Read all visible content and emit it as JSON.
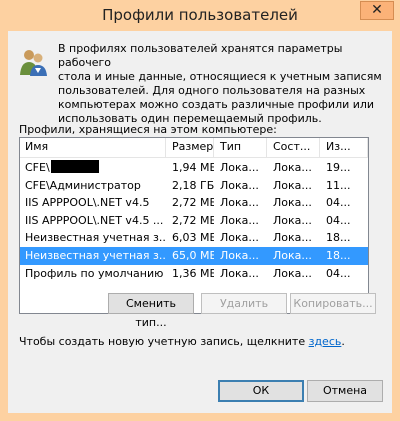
{
  "window": {
    "title": "Профили пользователей",
    "close_glyph": "✕"
  },
  "info": {
    "icon": "users-icon",
    "text": "В профилях пользователей хранятся параметры рабочего\nстола и иные данные, относящиеся к учетным записям\nпользователей. Для одного пользователя на разных\nкомпьютерах можно создать различные профили или\nиспользовать один перемещаемый профиль."
  },
  "profiles": {
    "label": "Профили, хранящиеся на этом компьютере:",
    "columns": [
      "Имя",
      "Размер",
      "Тип",
      "Сост...",
      "Из..."
    ],
    "rows": [
      {
        "name": "CFE\\",
        "size": "1,94 МБ",
        "type": "Лока...",
        "state": "Лока...",
        "modified": "19..."
      },
      {
        "name": "CFE\\Администратор",
        "size": "2,18 ГБ",
        "type": "Лока...",
        "state": "Лока...",
        "modified": "11..."
      },
      {
        "name": "IIS APPPOOL\\.NET v4.5",
        "size": "2,72 МБ",
        "type": "Лока...",
        "state": "Лока...",
        "modified": "04..."
      },
      {
        "name": "IIS APPPOOL\\.NET v4.5 ...",
        "size": "2,72 МБ",
        "type": "Лока...",
        "state": "Лока...",
        "modified": "04..."
      },
      {
        "name": "Неизвестная учетная з...",
        "size": "6,03 МБ",
        "type": "Лока...",
        "state": "Лока...",
        "modified": "18..."
      },
      {
        "name": "Неизвестная учетная з...",
        "size": "65,0 МБ",
        "type": "Лока...",
        "state": "Лока...",
        "modified": "18..."
      },
      {
        "name": "Профиль по умолчанию",
        "size": "1,36 МБ",
        "type": "Лока...",
        "state": "Лока...",
        "modified": "04..."
      }
    ],
    "selected_index": 5
  },
  "buttons": {
    "change_type": "Сменить тип...",
    "delete": "Удалить",
    "copy": "Копировать...",
    "ok": "ОК",
    "cancel": "Отмена"
  },
  "create": {
    "text": "Чтобы создать новую учетную запись, щелкните ",
    "link": "здесь",
    "suffix": "."
  }
}
